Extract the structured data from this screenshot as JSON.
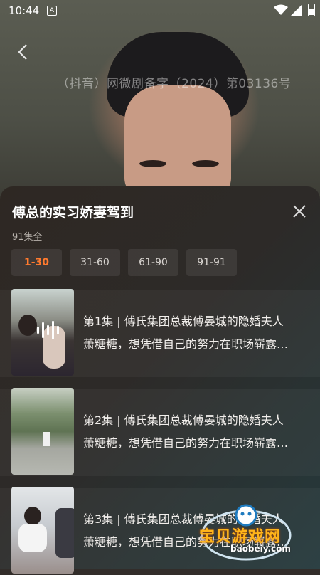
{
  "status_bar": {
    "time": "10:44",
    "app_glyph": "A"
  },
  "video": {
    "watermark": "（抖音）网微剧备字（2024）第03136号"
  },
  "sheet": {
    "title": "傅总的实习娇妻驾到",
    "episode_count": "91集全",
    "tabs": [
      {
        "label": "1-30",
        "active": true
      },
      {
        "label": "31-60",
        "active": false
      },
      {
        "label": "61-90",
        "active": false
      },
      {
        "label": "91-91",
        "active": false
      }
    ],
    "episodes": [
      {
        "line1": "第1集 | 傅氏集团总裁傅晏城的隐婚夫人",
        "line2": "萧糖糖，想凭借自己的努力在职场崭露…",
        "playing": true
      },
      {
        "line1": "第2集 | 傅氏集团总裁傅晏城的隐婚夫人",
        "line2": "萧糖糖，想凭借自己的努力在职场崭露…",
        "playing": false
      },
      {
        "line1": "第3集 | 傅氏集团总裁傅晏城的隐婚夫人",
        "line2": "萧糖糖，想凭借自己的努力在职场崭露…",
        "playing": false
      }
    ]
  },
  "site_watermark": {
    "name": "宝贝游戏网",
    "url": "baobeiy.com"
  },
  "colors": {
    "accent": "#ff7a2e",
    "sheet_bg": "#2d2a28"
  },
  "icons": {
    "back": "back-arrow-icon",
    "close": "close-icon",
    "playing": "equalizer-icon"
  }
}
